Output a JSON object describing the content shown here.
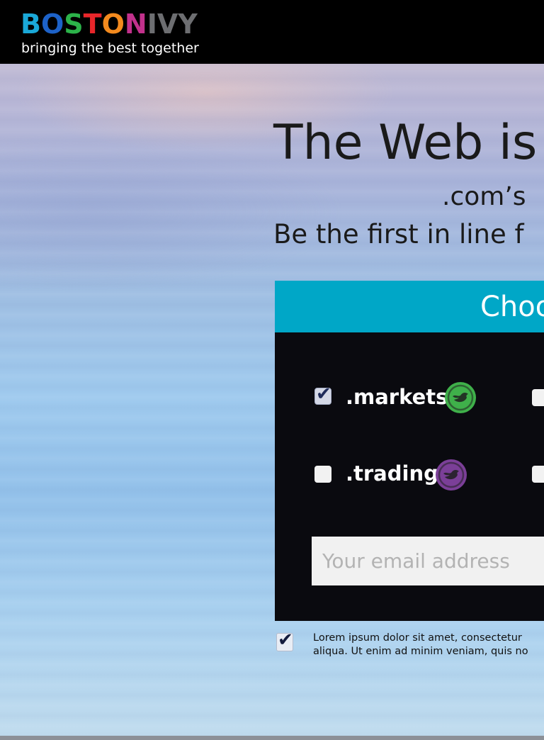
{
  "brand": {
    "logo_letters": [
      {
        "char": "B",
        "color": "#1aa8d8"
      },
      {
        "char": "O",
        "color": "#1d62c8"
      },
      {
        "char": "S",
        "color": "#2cb34a"
      },
      {
        "char": "T",
        "color": "#e8262a"
      },
      {
        "char": "O",
        "color": "#f38a1e"
      },
      {
        "char": "N",
        "color": "#c2318c"
      },
      {
        "char": "I",
        "color": "#6d6e71"
      },
      {
        "char": "V",
        "color": "#6d6e71"
      },
      {
        "char": "Y",
        "color": "#6d6e71"
      }
    ],
    "tagline": "bringing the best together"
  },
  "hero": {
    "headline": "The Web is",
    "subline": ".com’s",
    "subline2": "Be the first in line f"
  },
  "panel": {
    "title": "Choo",
    "header_color": "#00a7c7",
    "options": [
      {
        "label": ".markets",
        "checked": true,
        "icon": "green-bird-icon",
        "icon_color": "#3fb04a"
      },
      {
        "label": ".trading",
        "checked": false,
        "icon": "purple-bird-icon",
        "icon_color": "#7b3f98"
      }
    ],
    "email_placeholder": "Your email address"
  },
  "consent": {
    "checked": true,
    "line1": "Lorem ipsum dolor sit amet, consectetur",
    "line2": "aliqua. Ut enim ad minim veniam, quis no"
  }
}
